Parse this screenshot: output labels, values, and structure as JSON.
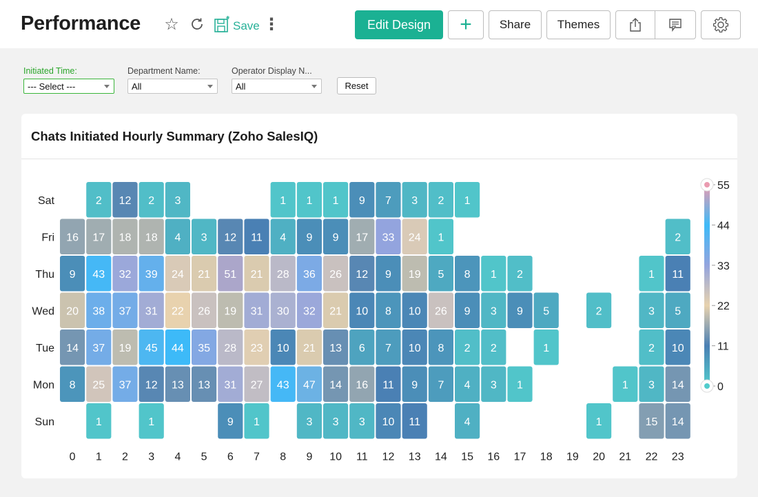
{
  "header": {
    "title": "Performance",
    "icons": [
      "star-icon",
      "refresh-icon",
      "save-icon",
      "more-vertical-icon"
    ],
    "save_label": "Save",
    "edit_design_label": "Edit Design",
    "add_label": "+",
    "share_label": "Share",
    "themes_label": "Themes",
    "accent_color": "#1bb193"
  },
  "filters": {
    "items": [
      {
        "label": "Initiated Time:",
        "value": "--- Select ---",
        "active": true
      },
      {
        "label": "Department Name:",
        "value": "All",
        "active": false
      },
      {
        "label": "Operator Display N...",
        "value": "All",
        "active": false
      }
    ],
    "reset_label": "Reset"
  },
  "card": {
    "title": "Chats Initiated Hourly Summary (Zoho SalesIQ)"
  },
  "chart_data": {
    "type": "heatmap",
    "title": "Chats Initiated Hourly Summary (Zoho SalesIQ)",
    "xlabel": "",
    "ylabel": "",
    "x": [
      "0",
      "1",
      "2",
      "3",
      "4",
      "5",
      "6",
      "7",
      "8",
      "9",
      "10",
      "11",
      "12",
      "13",
      "14",
      "15",
      "16",
      "17",
      "18",
      "19",
      "20",
      "21",
      "22",
      "23"
    ],
    "y": [
      "Sat",
      "Fri",
      "Thu",
      "Wed",
      "Tue",
      "Mon",
      "Sun"
    ],
    "values": [
      [
        null,
        2,
        12,
        2,
        3,
        null,
        null,
        null,
        1,
        1,
        1,
        9,
        7,
        3,
        2,
        1,
        null,
        null,
        null,
        null,
        null,
        null,
        null,
        null
      ],
      [
        16,
        17,
        18,
        18,
        4,
        3,
        12,
        11,
        4,
        9,
        9,
        17,
        33,
        24,
        1,
        null,
        null,
        null,
        null,
        null,
        null,
        null,
        null,
        2
      ],
      [
        9,
        43,
        32,
        39,
        24,
        21,
        51,
        21,
        28,
        36,
        26,
        12,
        9,
        19,
        5,
        8,
        1,
        2,
        null,
        null,
        null,
        null,
        1,
        11
      ],
      [
        20,
        38,
        37,
        31,
        22,
        26,
        19,
        31,
        30,
        32,
        21,
        10,
        8,
        10,
        26,
        9,
        3,
        9,
        5,
        null,
        2,
        null,
        3,
        5
      ],
      [
        14,
        37,
        19,
        45,
        44,
        35,
        28,
        23,
        10,
        21,
        13,
        6,
        7,
        10,
        8,
        2,
        2,
        null,
        1,
        null,
        null,
        null,
        2,
        10
      ],
      [
        8,
        25,
        37,
        12,
        13,
        13,
        31,
        27,
        43,
        47,
        14,
        16,
        11,
        9,
        7,
        4,
        3,
        1,
        null,
        null,
        null,
        1,
        3,
        14
      ],
      [
        null,
        1,
        null,
        1,
        null,
        null,
        9,
        1,
        null,
        3,
        3,
        3,
        10,
        11,
        null,
        4,
        null,
        null,
        null,
        null,
        1,
        null,
        15,
        14
      ]
    ],
    "color_scale": {
      "range": [
        0,
        55
      ],
      "ticks": [
        0,
        11,
        22,
        33,
        44,
        55
      ],
      "stops": [
        {
          "value": 0,
          "color": "#52cccc"
        },
        {
          "value": 11,
          "color": "#4a80b4"
        },
        {
          "value": 22,
          "color": "#e8d2ae"
        },
        {
          "value": 33,
          "color": "#93a4de"
        },
        {
          "value": 44,
          "color": "#3dbaf8"
        },
        {
          "value": 55,
          "color": "#ea9bb0"
        }
      ]
    },
    "legend": "right",
    "grid": false
  }
}
